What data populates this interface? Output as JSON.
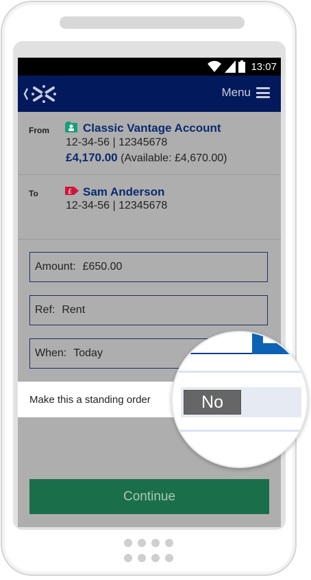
{
  "status_bar": {
    "time": "13:07",
    "icons": [
      "wifi-icon",
      "signal-icon",
      "battery-icon"
    ]
  },
  "header": {
    "logo": "bank-logo-icon",
    "menu_label": "Menu",
    "menu_icon": "hamburger-icon"
  },
  "from_account": {
    "label": "From",
    "name": "Classic Vantage Account",
    "sort_account": "12-34-56 | 12345678",
    "balance": "£4,170.00",
    "available": "(Available: £4,670.00)",
    "icon": "account-card-icon",
    "icon_color": "#18a07a"
  },
  "to_account": {
    "label": "To",
    "name": "Sam Anderson",
    "sort_account": "12-34-56 | 12345678",
    "icon": "pound-tag-icon",
    "icon_color": "#d2133c"
  },
  "form": {
    "amount": {
      "label": "Amount:",
      "value": "£650.00"
    },
    "ref": {
      "label": "Ref:",
      "value": "Rent"
    },
    "when": {
      "label": "When:",
      "value": "Today"
    },
    "standing_order": {
      "label": "Make this a standing order",
      "toggle_value": "No"
    },
    "continue_label": "Continue"
  },
  "colors": {
    "header_bg": "#02195b",
    "accent_blue": "#0b2a6e",
    "continue_bg": "#1b6e4a",
    "toggle_bg": "#666666"
  }
}
